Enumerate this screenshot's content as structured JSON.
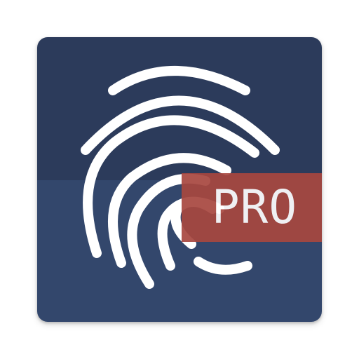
{
  "app_icon": {
    "name": "fingerprint-app-icon",
    "badge_label": "PRO",
    "colors": {
      "background_top": "#2c3b5b",
      "background_bottom": "#33476c",
      "fingerprint": "#ffffff",
      "badge": "#a8473f"
    }
  }
}
